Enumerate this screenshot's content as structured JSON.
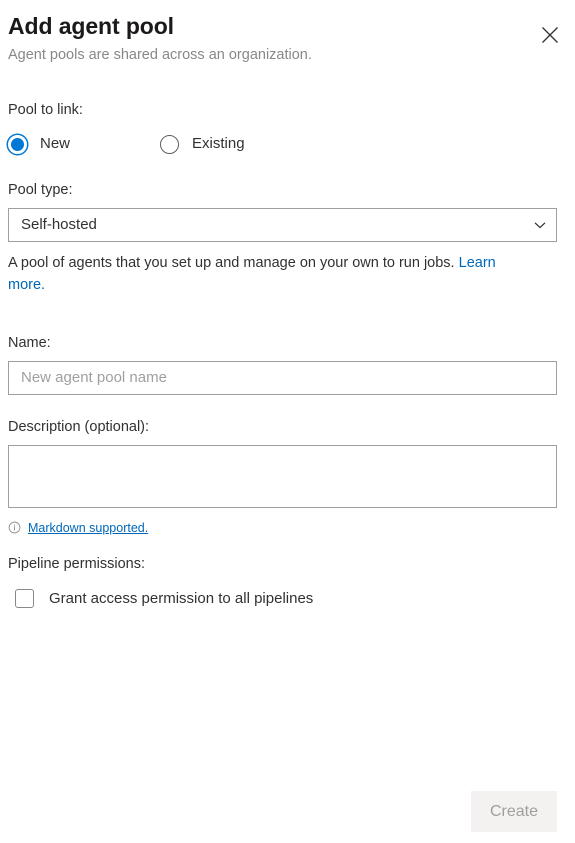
{
  "dialog": {
    "title": "Add agent pool",
    "subtitle": "Agent pools are shared across an organization.",
    "close_icon": "close-icon"
  },
  "pool_to_link": {
    "label": "Pool to link:",
    "options": [
      {
        "label": "New",
        "selected": true
      },
      {
        "label": "Existing",
        "selected": false
      }
    ]
  },
  "pool_type": {
    "label": "Pool type:",
    "selected_value": "Self-hosted",
    "chevron_icon": "chevron-down-icon",
    "description_prefix": "A pool of agents that you set up and manage on your own to run jobs. ",
    "description_link": "Learn more."
  },
  "name_field": {
    "label": "Name:",
    "value": "",
    "placeholder": "New agent pool name"
  },
  "description_field": {
    "label": "Description (optional):",
    "value": "",
    "placeholder": "",
    "info_icon": "info-circle-icon",
    "markdown_note": "Markdown supported."
  },
  "pipeline_permissions": {
    "label": "Pipeline permissions:",
    "checkbox_label": "Grant access permission to all pipelines",
    "checked": false
  },
  "footer": {
    "create_label": "Create",
    "create_disabled": true
  },
  "colors": {
    "accent": "#0078d4",
    "link": "#0067b8",
    "text": "#323130",
    "muted": "#8a8886",
    "border": "#a19f9d",
    "disabled_bg": "#f3f2f1"
  }
}
